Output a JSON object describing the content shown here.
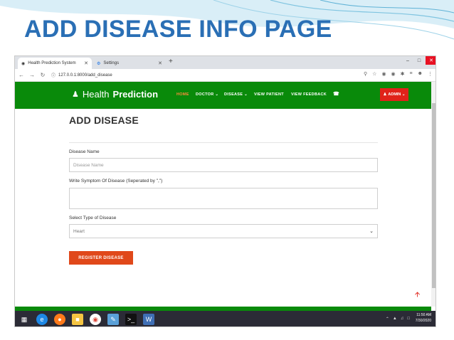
{
  "slide": {
    "title": "ADD DISEASE INFO PAGE",
    "title_color": "#2a6fb5"
  },
  "browser": {
    "tabs": [
      {
        "label": "Health Prediction System",
        "icon": "globe-icon",
        "active": true
      },
      {
        "label": "Settings",
        "icon": "gear-icon",
        "active": false
      }
    ],
    "url": "127.0.0.1:8000/add_disease"
  },
  "site": {
    "brand_prefix": "Health",
    "brand_suffix": "Prediction",
    "nav": {
      "home": "HOME",
      "doctor": "DOCTOR ⌄",
      "disease": "DISEASE ⌄",
      "view_patient": "VIEW PATIENT",
      "view_feedback": "VIEW FEEDBACK"
    },
    "admin_label": "ADMIN ⌄",
    "accent_green": "#098a0a",
    "accent_red": "#e0231a",
    "accent_orange": "#e0481a"
  },
  "form": {
    "title": "ADD DISEASE",
    "disease_name_label": "Disease Name",
    "disease_name_placeholder": "Disease Name",
    "symptom_label": "Write Symptom Of Disease (Seperated by \",\")",
    "type_label": "Select Type of Disease",
    "type_selected": "Heart",
    "submit_label": "REGISTER DISEASE"
  },
  "taskbar": {
    "time": "11:50 AM",
    "date": "7/30/2020"
  }
}
